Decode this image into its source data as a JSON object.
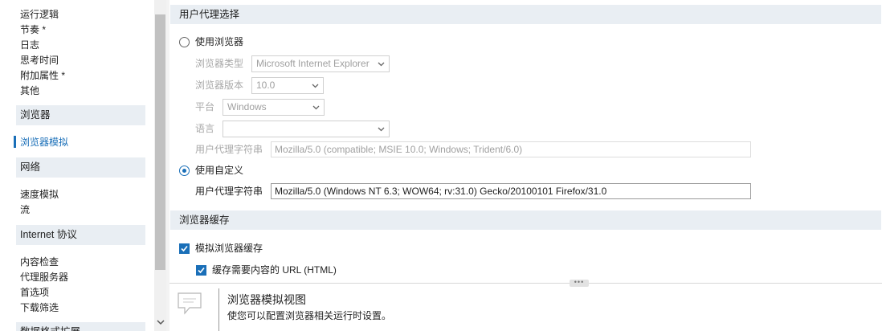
{
  "sidebar": {
    "items_top": [
      "运行逻辑",
      "节奏 *",
      "日志",
      "思考时间",
      "附加属性 *",
      "其他"
    ],
    "group_browser": "浏览器",
    "browser_emulation": "浏览器模拟",
    "group_network": "网络",
    "network_items": [
      "速度模拟",
      "流"
    ],
    "group_internet": "Internet 协议",
    "internet_items": [
      "内容检查",
      "代理服务器",
      "首选项",
      "下载筛选"
    ],
    "group_data_format": "数据格式扩展"
  },
  "user_agent": {
    "section_title": "用户代理选择",
    "use_browser_label": "使用浏览器",
    "browser_type_label": "浏览器类型",
    "browser_type_value": "Microsoft Internet Explorer",
    "browser_version_label": "浏览器版本",
    "browser_version_value": "10.0",
    "platform_label": "平台",
    "platform_value": "Windows",
    "language_label": "语言",
    "language_value": "",
    "ua_string_label": "用户代理字符串",
    "ua_string_browser_value": "Mozilla/5.0 (compatible; MSIE 10.0; Windows; Trident/6.0)",
    "use_custom_label": "使用自定义",
    "custom_ua_label": "用户代理字符串",
    "custom_ua_value": "Mozilla/5.0 (Windows NT 6.3; WOW64; rv:31.0) Gecko/20100101 Firefox/31.0"
  },
  "browser_cache": {
    "section_title": "浏览器缓存",
    "simulate_cache_label": "模拟浏览器缓存",
    "cache_url_label": "缓存需要内容的 URL (HTML)"
  },
  "help": {
    "grip": "•••",
    "title": "浏览器模拟视图",
    "description": "使您可以配置浏览器相关运行时设置。"
  },
  "colors": {
    "accent": "#1a6fb8",
    "section_bg": "#e9eef3",
    "disabled_text": "#a8a8a8"
  }
}
